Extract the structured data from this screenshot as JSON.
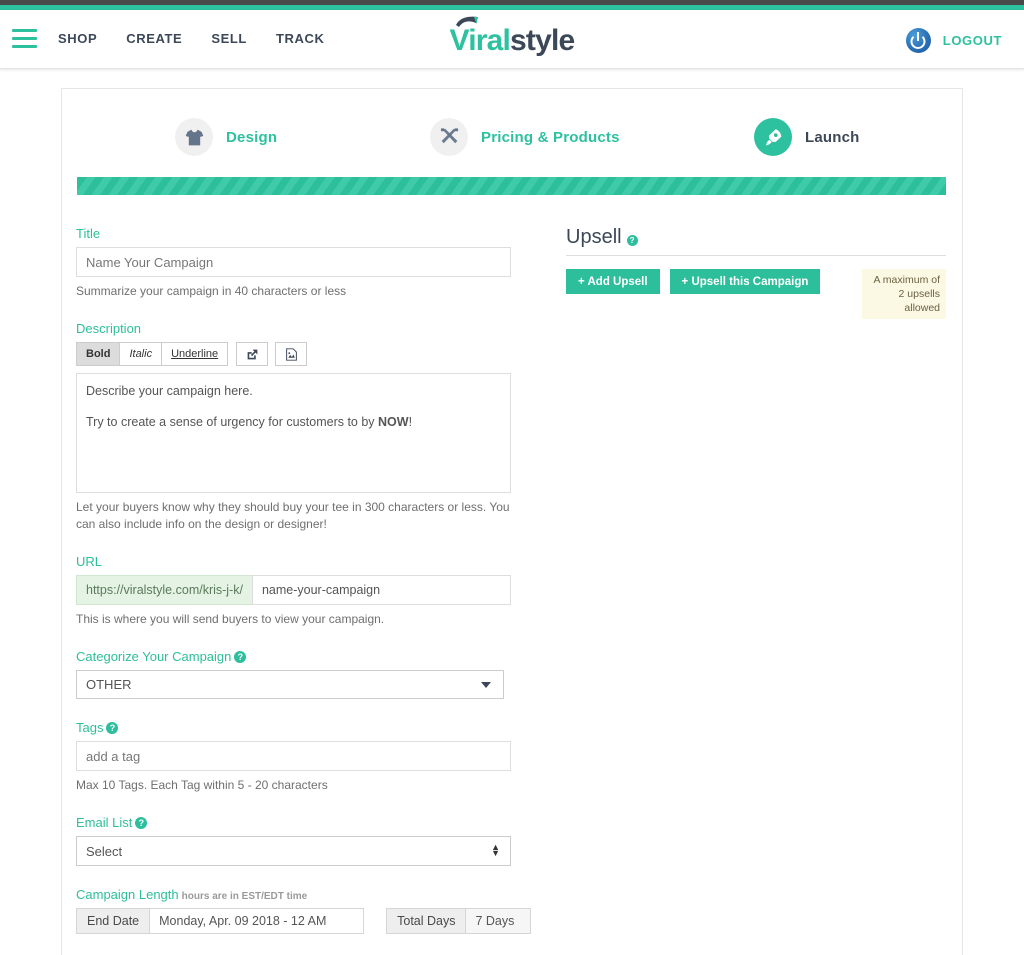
{
  "header": {
    "menu_icon": "hamburger-icon",
    "nav": [
      {
        "label": "SHOP"
      },
      {
        "label": "CREATE"
      },
      {
        "label": "SELL"
      },
      {
        "label": "TRACK"
      }
    ],
    "logo": {
      "part1": "Viral",
      "part2": "style"
    },
    "logout_label": "LOGOUT",
    "logout_icon": "power-icon"
  },
  "steps": [
    {
      "label": "Design",
      "icon": "tshirt-icon",
      "active": false
    },
    {
      "label": "Pricing & Products",
      "icon": "ruler-pencil-icon",
      "active": false
    },
    {
      "label": "Launch",
      "icon": "rocket-icon",
      "active": true
    }
  ],
  "form": {
    "title": {
      "label": "Title",
      "placeholder": "Name Your Campaign",
      "value": "",
      "help": "Summarize your campaign in 40 characters or less"
    },
    "description": {
      "label": "Description",
      "toolbar": {
        "bold": "Bold",
        "italic": "Italic",
        "underline": "Underline",
        "link_icon": "share-link-icon",
        "image_icon": "insert-image-icon"
      },
      "line1": "Describe your campaign here.",
      "line2_prefix": "Try to create a sense of urgency for customers to by ",
      "line2_bold": "NOW",
      "line2_suffix": "!",
      "help": "Let your buyers know why they should buy your tee in 300 characters or less. You can also include info on the design or designer!"
    },
    "url": {
      "label": "URL",
      "prefix": "https://viralstyle.com/kris-j-k/",
      "value": "name-your-campaign",
      "help": "This is where you will send buyers to view your campaign."
    },
    "category": {
      "label": "Categorize Your Campaign",
      "help_icon": "question-mark-icon",
      "selected": "OTHER",
      "options": [
        "OTHER"
      ]
    },
    "tags": {
      "label": "Tags",
      "help_icon": "question-mark-icon",
      "placeholder": "add a tag",
      "value": "",
      "help": "Max 10 Tags. Each Tag within 5 - 20 characters"
    },
    "email_list": {
      "label": "Email List",
      "help_icon": "question-mark-icon",
      "selected": "Select",
      "options": [
        "Select"
      ]
    },
    "campaign_length": {
      "label": "Campaign Length",
      "sub_label": "hours are in EST/EDT time",
      "end_date_label": "End Date",
      "end_date_value": "Monday, Apr. 09 2018 - 12 AM",
      "total_days_label": "Total Days",
      "total_days_value": "7 Days"
    }
  },
  "upsell": {
    "title": "Upsell",
    "help_icon": "question-mark-icon",
    "add_button": "+ Add Upsell",
    "campaign_button": "+ Upsell this Campaign",
    "notice": "A maximum of 2 upsells allowed"
  },
  "colors": {
    "teal": "#2dbe9b",
    "teal_bright": "#2dc1a0",
    "dark_navy": "#3c4858",
    "notice_bg": "#fbf8e3",
    "url_prefix_bg": "#e4f3e4",
    "power_blue": "#2b6fb5"
  }
}
